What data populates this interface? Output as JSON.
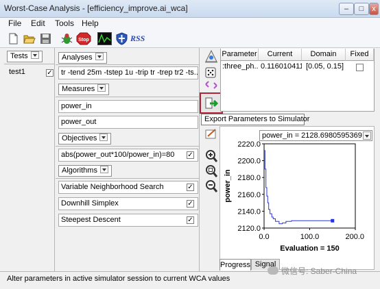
{
  "window": {
    "title": "Worst-Case Analysis - [efficiency_improve.ai_wca]",
    "minimize_glyph": "–",
    "maximize_glyph": "□",
    "close_glyph": "x"
  },
  "menu": [
    "File",
    "Edit",
    "Tools",
    "Help"
  ],
  "toolbar": {
    "icons": [
      "new-file-icon",
      "open-folder-icon",
      "save-icon",
      "bug-icon",
      "stop-icon",
      "waveform-icon",
      "shield-icon",
      "rss-icon"
    ],
    "stop_label": "Stop",
    "rss_label": "RSS"
  },
  "tests": {
    "header": "Tests",
    "items": [
      {
        "label": "test1",
        "checked": true
      }
    ]
  },
  "analyses": {
    "header": "Analyses",
    "value": "tr -tend 25m -tstep 1u -trip tr -trep tr2 -ts..."
  },
  "measures": {
    "header": "Measures",
    "items": [
      "power_in",
      "power_out"
    ]
  },
  "objectives": {
    "header": "Objectives",
    "items": [
      {
        "label": "abs(power_out*100/power_in)=80",
        "checked": true
      }
    ]
  },
  "algorithms": {
    "header": "Algorithms",
    "items": [
      {
        "label": "Variable Neighborhood Search",
        "checked": true
      },
      {
        "label": "Downhill Simplex",
        "checked": true
      },
      {
        "label": "Steepest Descent",
        "checked": true
      }
    ]
  },
  "side_icons": [
    "parameters-icon",
    "dice-icon",
    "sync-icon",
    "export-arrow-icon",
    "chart-edit-icon",
    "zoom-in-icon",
    "zoom-fit-icon",
    "zoom-out-icon"
  ],
  "param_table": {
    "columns": [
      "Parameter",
      "Current",
      "Domain",
      "Fixed"
    ],
    "rows": [
      {
        "parameter": ":three_ph...",
        "current": "0.116010411",
        "domain": "[0.05, 0.15]",
        "fixed": false
      }
    ]
  },
  "tooltip": "Export Parameters to Simulator",
  "chart_selector": "power_in = 2128.6980595369",
  "chart_tabs": [
    "Progress",
    "Signal"
  ],
  "chart_data": {
    "type": "line",
    "xlabel": "Evaluation = 150",
    "ylabel": "power_in",
    "xlim": [
      0,
      200
    ],
    "ylim": [
      2120,
      2220
    ],
    "x_ticks": [
      "0.0",
      "100.0",
      "200.0"
    ],
    "y_ticks": [
      "2120.0",
      "2140.0",
      "2160.0",
      "2180.0",
      "2200.0",
      "2220.0"
    ],
    "series": [
      {
        "x": [
          0,
          2,
          2,
          4,
          4,
          6,
          6,
          8,
          8,
          10,
          10,
          13,
          13,
          17,
          17,
          20,
          20,
          25,
          25,
          33,
          33,
          40,
          40,
          48,
          48,
          60,
          60,
          150
        ],
        "y": [
          2212,
          2212,
          2190,
          2190,
          2168,
          2168,
          2158,
          2158,
          2150,
          2150,
          2142,
          2142,
          2137,
          2137,
          2133,
          2133,
          2131,
          2131,
          2128,
          2128,
          2125,
          2125,
          2126,
          2126,
          2128,
          2128,
          2128.7,
          2128.7
        ],
        "color": "#2a35d8"
      }
    ],
    "grid": false
  },
  "status": "Alter parameters in active simulator session to current WCA values",
  "watermark": "微信号: Saber-China"
}
